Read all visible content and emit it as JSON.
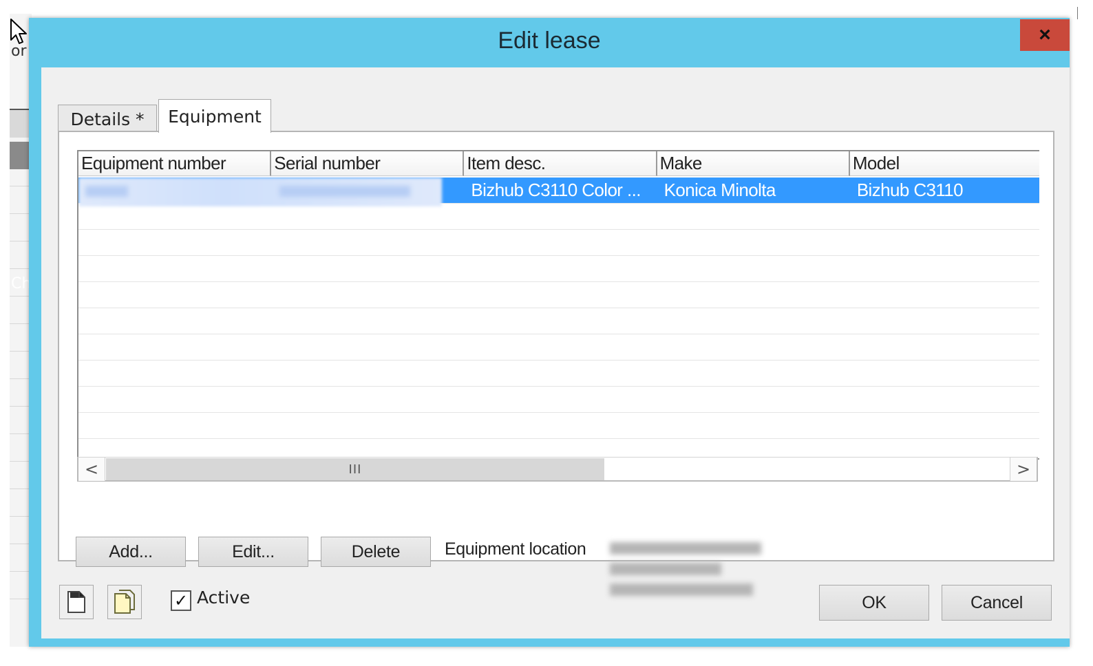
{
  "dialog": {
    "title": "Edit lease",
    "close_label": "×"
  },
  "tabs": [
    {
      "label": "Details *"
    },
    {
      "label": "Equipment"
    }
  ],
  "grid": {
    "columns": [
      "Equipment number",
      "Serial number",
      "Item desc.",
      "Make",
      "Model"
    ],
    "rows": [
      {
        "equipment_number": "",
        "serial_number": "",
        "item_desc": "Bizhub C3110 Color ...",
        "make": "Konica Minolta",
        "model": "Bizhub C3110",
        "selected": true
      }
    ],
    "empty_row_count": 9
  },
  "scrollbar": {
    "left_arrow": "<",
    "right_arrow": ">",
    "thumb_grip": "III"
  },
  "actions": {
    "add_label": "Add...",
    "edit_label": "Edit...",
    "delete_label": "Delete"
  },
  "equipment_location": {
    "label": "Equipment location"
  },
  "footer": {
    "active_label": "Active",
    "active_checked": true,
    "check_mark": "✓",
    "ok_label": "OK",
    "cancel_label": "Cancel"
  },
  "background": {
    "fragment_top": "or",
    "fragment_mid": "Ch"
  },
  "colors": {
    "titlebar": "#62c9ea",
    "close": "#c9493b",
    "selection": "#3399ff"
  },
  "icons": [
    "cursor-icon",
    "close-icon",
    "new-document-icon",
    "copy-document-icon",
    "checkbox-icon",
    "chevron-left-icon",
    "chevron-right-icon"
  ]
}
